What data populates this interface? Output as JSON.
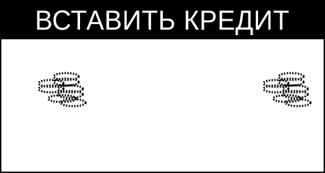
{
  "screen": {
    "title": "ВСТАВИТЬ КРЕДИТ",
    "colors": {
      "background": "#ffffff",
      "foreground": "#000000",
      "title_text": "#ffffff"
    }
  },
  "icons": {
    "left": "coin-stack-icon",
    "right": "coin-stack-icon"
  }
}
